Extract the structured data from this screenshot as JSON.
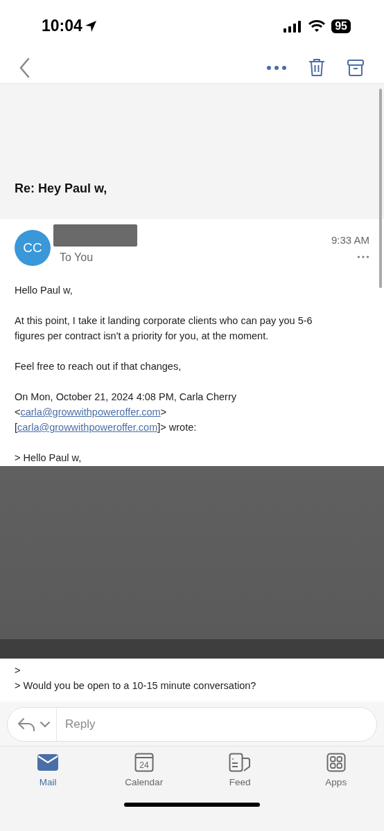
{
  "status_bar": {
    "time": "10:04",
    "battery": "95"
  },
  "subject": "Re: Hey Paul w,",
  "message": {
    "avatar": "CC",
    "recipient": "To You",
    "time": "9:33 AM"
  },
  "body_top": [
    {
      "lines": [
        [
          {
            "text": "Hello Paul w,",
            "link": false
          }
        ]
      ]
    },
    {
      "lines": [
        [
          {
            "text": "At this point, I take it landing corporate clients who can pay you 5-6",
            "link": false
          }
        ],
        [
          {
            "text": "figures per contract isn't a priority for you, at the moment.",
            "link": false
          }
        ]
      ]
    },
    {
      "lines": [
        [
          {
            "text": "Feel free to reach out if that changes,",
            "link": false
          }
        ]
      ]
    },
    {
      "gap": true,
      "lines": [
        [
          {
            "text": "On Mon, October 21, 2024 4:08 PM, Carla Cherry",
            "link": false
          }
        ],
        [
          {
            "text": "<",
            "link": false
          },
          {
            "text": "carla@growwithpoweroffer.com",
            "link": true
          },
          {
            "text": ">",
            "link": false
          }
        ],
        [
          {
            "text": "[",
            "link": false
          },
          {
            "text": "carla@growwithpoweroffer.com",
            "link": true
          },
          {
            "text": "]> wrote:",
            "link": false
          }
        ]
      ]
    },
    {
      "lines": [
        [
          {
            "text": "> Hello Paul w,",
            "link": false
          }
        ]
      ]
    }
  ],
  "body_bottom": [
    {
      "lines": [
        [
          {
            "text": ">",
            "link": false
          }
        ],
        [
          {
            "text": "> Would you be open to a 10-15 minute conversation?",
            "link": false
          }
        ]
      ]
    }
  ],
  "reply": {
    "placeholder": "Reply"
  },
  "tabs": [
    {
      "label": "Mail",
      "selected": true,
      "kind": "mail"
    },
    {
      "label": "Calendar",
      "selected": false,
      "kind": "calendar",
      "day": "24"
    },
    {
      "label": "Feed",
      "selected": false,
      "kind": "feed"
    },
    {
      "label": "Apps",
      "selected": false,
      "kind": "apps"
    }
  ]
}
